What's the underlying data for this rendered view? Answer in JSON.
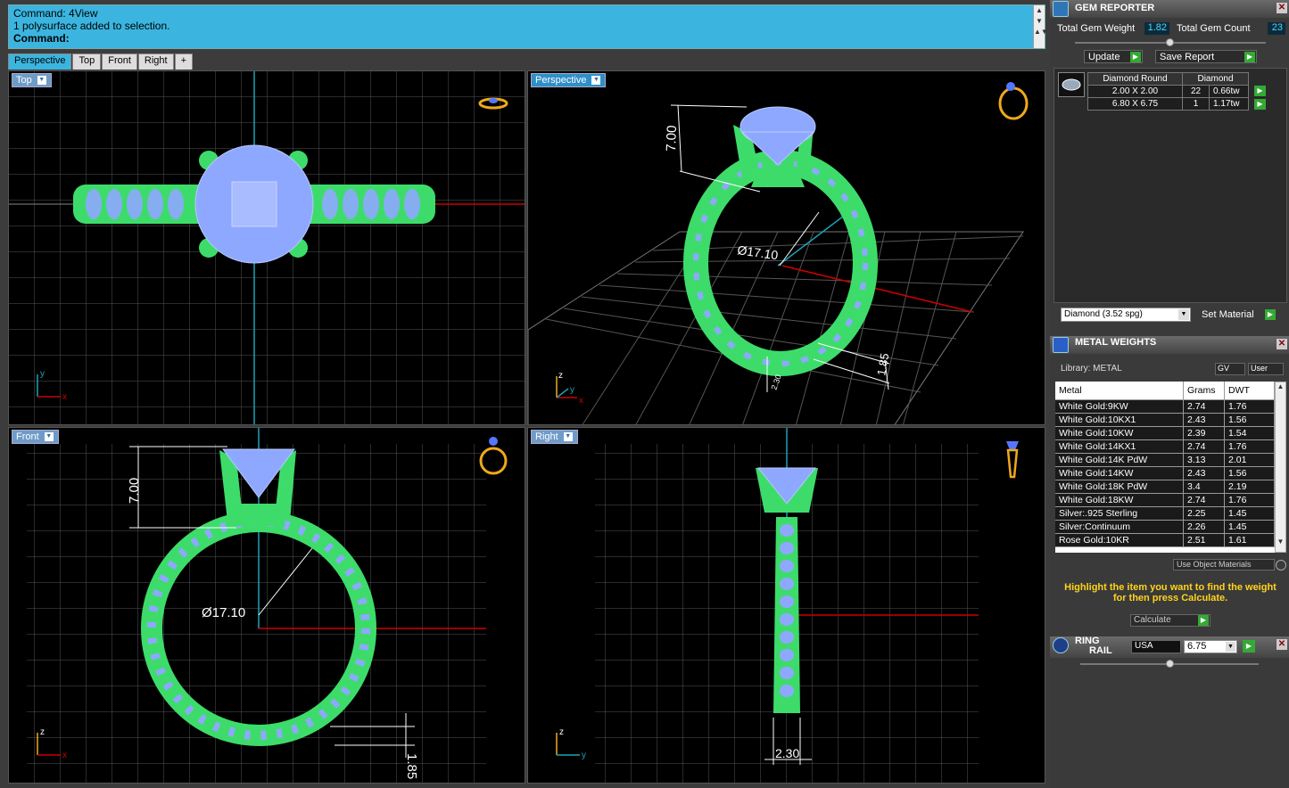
{
  "command": {
    "line1": "Command: 4View",
    "line2": "1 polysurface added to selection.",
    "prompt": "Command:"
  },
  "tabs": [
    "Perspective",
    "Top",
    "Front",
    "Right",
    "+"
  ],
  "viewports": {
    "top": "Top",
    "perspective": "Perspective",
    "front": "Front",
    "right": "Right"
  },
  "dims": {
    "height": "7.00",
    "diameter": "Ø17.10",
    "band_h": "1.85",
    "band_w": "2.30",
    "band_w_persp": "2.30"
  },
  "axes": {
    "x": "x",
    "y": "y",
    "z": "z"
  },
  "gem_reporter": {
    "title": "GEM REPORTER",
    "total_weight_label": "Total Gem Weight",
    "total_weight": "1.82",
    "total_count_label": "Total Gem Count",
    "total_count": "23",
    "update": "Update",
    "save": "Save Report",
    "table_head": [
      "Diamond Round",
      "Diamond"
    ],
    "rows": [
      [
        "2.00 X 2.00",
        "22",
        "0.66tw"
      ],
      [
        "6.80 X 6.75",
        "1",
        "1.17tw"
      ]
    ],
    "material": "Diamond    (3.52 spg)",
    "set_material": "Set Material"
  },
  "metal_weights": {
    "title": "METAL WEIGHTS",
    "library": "Library: METAL",
    "gv": "GV",
    "user": "User",
    "headers": [
      "Metal",
      "Grams",
      "DWT"
    ],
    "rows": [
      [
        "White Gold:9KW",
        "2.74",
        "1.76"
      ],
      [
        "White Gold:10KX1",
        "2.43",
        "1.56"
      ],
      [
        "White Gold:10KW",
        "2.39",
        "1.54"
      ],
      [
        "White Gold:14KX1",
        "2.74",
        "1.76"
      ],
      [
        "White Gold:14K PdW",
        "3.13",
        "2.01"
      ],
      [
        "White Gold:14KW",
        "2.43",
        "1.56"
      ],
      [
        "White Gold:18K PdW",
        "3.4",
        "2.19"
      ],
      [
        "White Gold:18KW",
        "2.74",
        "1.76"
      ],
      [
        "Silver:.925 Sterling",
        "2.25",
        "1.45"
      ],
      [
        "Silver:Continuum",
        "2.26",
        "1.45"
      ],
      [
        "Rose Gold:10KR",
        "2.51",
        "1.61"
      ]
    ],
    "use_obj": "Use Object Materials",
    "hint1": "Highlight the item you want to find the weight",
    "hint2": "for then press Calculate.",
    "calculate": "Calculate"
  },
  "ring_rail": {
    "title1": "RING",
    "title2": "RAIL",
    "country": "USA",
    "size": "6.75"
  },
  "colors": {
    "accent": "#3bb5e0",
    "green": "#3ddc6a",
    "blue": "#8fa8ff",
    "gold": "#f0a81c"
  }
}
